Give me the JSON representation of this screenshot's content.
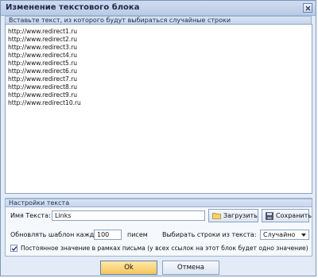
{
  "window": {
    "title": "Изменение текстового блока"
  },
  "editor": {
    "header": "Вставьте текст, из которого будут выбираться случайные строки",
    "lines": [
      "http://www.redirect1.ru",
      "http://www.redirect2.ru",
      "http://www.redirect3.ru",
      "http://www.redirect4.ru",
      "http://www.redirect5.ru",
      "http://www.redirect6.ru",
      "http://www.redirect7.ru",
      "http://www.redirect8.ru",
      "http://www.redirect9.ru",
      "http://www.redirect10.ru"
    ]
  },
  "settings": {
    "header": "Настройки текста",
    "name_label": "Имя Текста:",
    "name_value": "Links",
    "load_button": "Загрузить",
    "save_button": "Сохранить",
    "update_label": "Обновлять шаблон каждые:",
    "update_value": "100",
    "update_unit": "писем",
    "choose_label": "Выбирать строки из текста:",
    "choose_value": "Случайно",
    "constant_label": "Постоянное значение в рамках письма (у всех ссылок на этот блок будет одно значение)",
    "constant_checked": true
  },
  "footer": {
    "ok": "Ok",
    "cancel": "Отмена"
  },
  "icons": {
    "close": "close-icon",
    "load": "folder-icon",
    "save": "floppy-icon",
    "dropdown": "chevron-down-icon",
    "check": "checkmark-icon"
  }
}
